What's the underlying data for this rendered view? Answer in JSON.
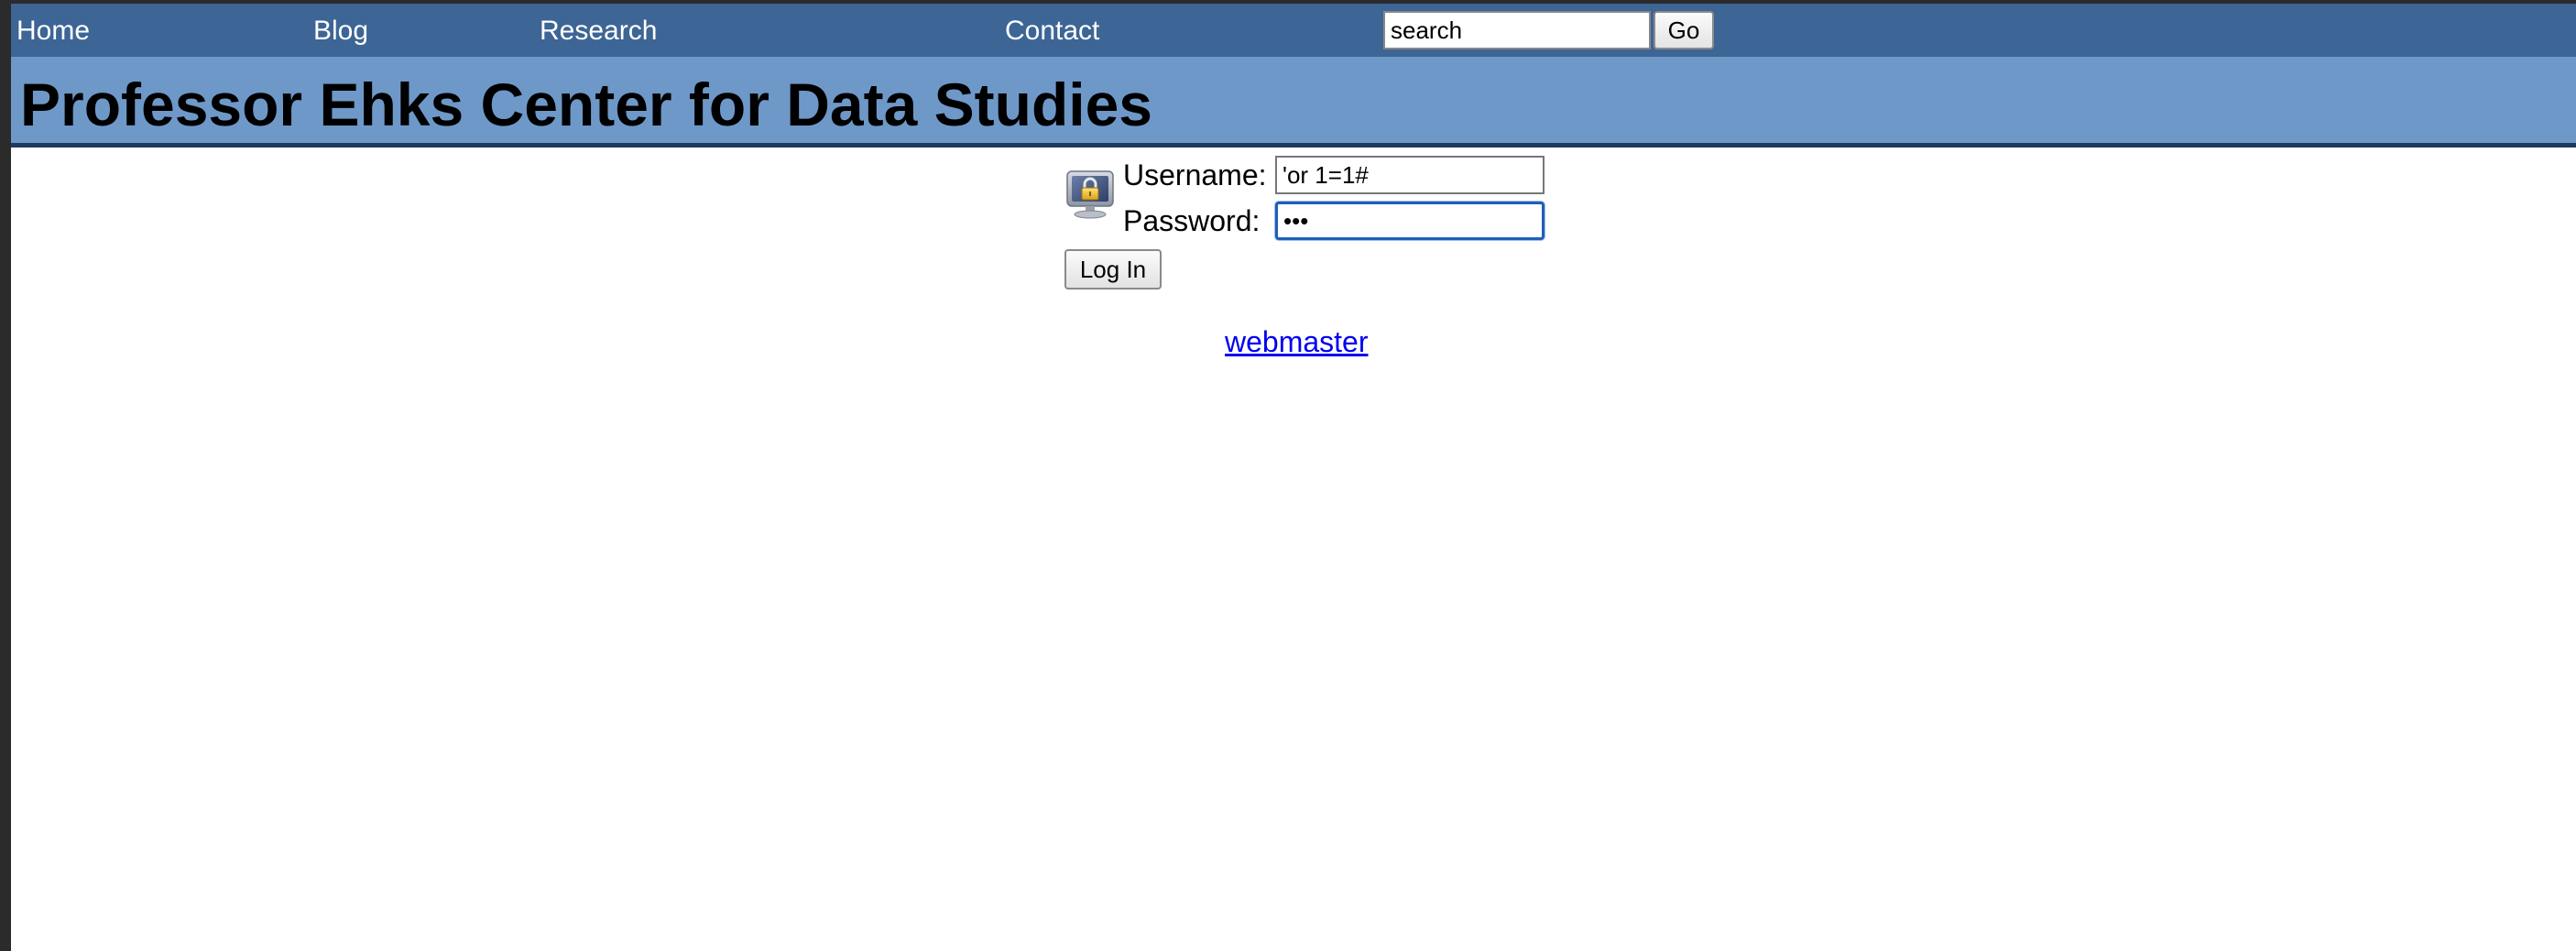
{
  "nav": {
    "items": [
      {
        "label": "Home"
      },
      {
        "label": "Blog"
      },
      {
        "label": "Research"
      },
      {
        "label": "Contact"
      }
    ],
    "search": {
      "value": "search",
      "button_label": "Go"
    }
  },
  "banner": {
    "title": "Professor Ehks Center for Data Studies"
  },
  "login": {
    "icon": "lock-computer-icon",
    "username_label": "Username:",
    "username_value": "'or 1=1#",
    "password_label": "Password:",
    "password_value": "abc",
    "submit_label": "Log In"
  },
  "footer": {
    "webmaster_link": "webmaster"
  },
  "colors": {
    "nav_background": "#3d6595",
    "banner_background": "#6e98c8",
    "banner_border": "#1e3a5f",
    "link": "#0000ee",
    "focus_ring": "#1f5fb8"
  }
}
